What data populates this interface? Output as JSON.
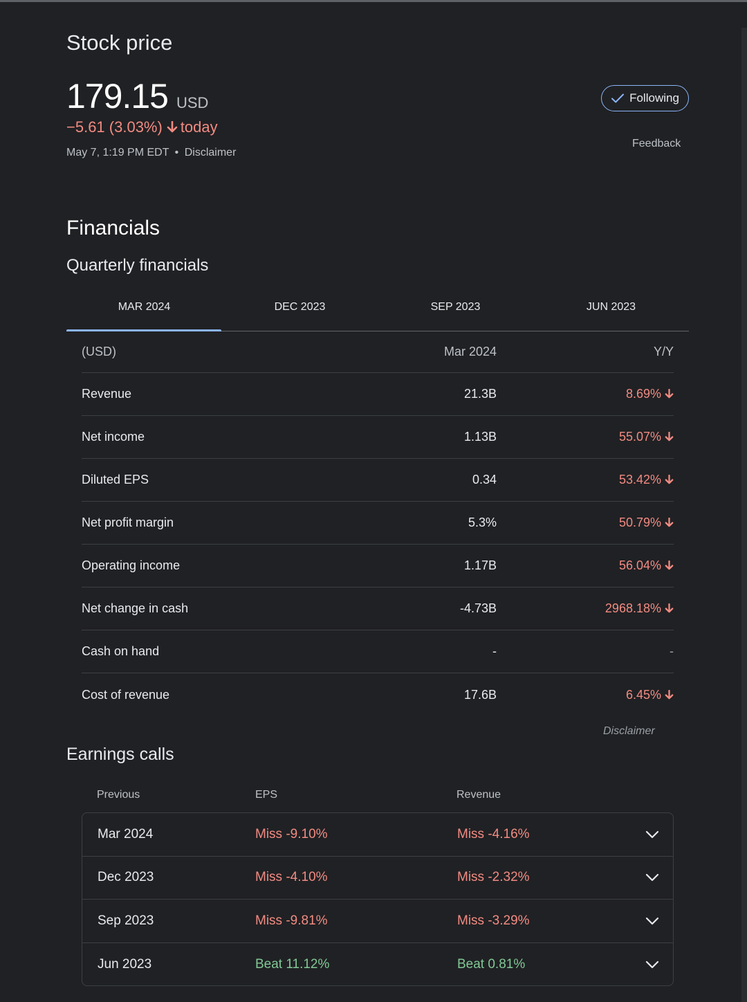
{
  "stock": {
    "title": "Stock price",
    "price": "179.15",
    "currency": "USD",
    "change": "−5.61 (3.03%)",
    "change_suffix": "today",
    "timestamp": "May 7, 1:19 PM EDT",
    "separator": "•",
    "disclaimer": "Disclaimer",
    "following_label": "Following",
    "feedback_label": "Feedback",
    "change_color": "#f28b82"
  },
  "financials": {
    "title": "Financials",
    "subtitle": "Quarterly financials",
    "tabs": [
      {
        "label": "MAR 2024",
        "active": true
      },
      {
        "label": "DEC 2023",
        "active": false
      },
      {
        "label": "SEP 2023",
        "active": false
      },
      {
        "label": "JUN 2023",
        "active": false
      }
    ],
    "header": {
      "label": "(USD)",
      "value": "Mar 2024",
      "yy": "Y/Y"
    },
    "rows": [
      {
        "label": "Revenue",
        "value": "21.3B",
        "yy": "8.69%",
        "trend": "down"
      },
      {
        "label": "Net income",
        "value": "1.13B",
        "yy": "55.07%",
        "trend": "down"
      },
      {
        "label": "Diluted EPS",
        "value": "0.34",
        "yy": "53.42%",
        "trend": "down"
      },
      {
        "label": "Net profit margin",
        "value": "5.3%",
        "yy": "50.79%",
        "trend": "down"
      },
      {
        "label": "Operating income",
        "value": "1.17B",
        "yy": "56.04%",
        "trend": "down"
      },
      {
        "label": "Net change in cash",
        "value": "-4.73B",
        "yy": "2968.18%",
        "trend": "down"
      },
      {
        "label": "Cash on hand",
        "value": "-",
        "yy": "-",
        "trend": "none"
      },
      {
        "label": "Cost of revenue",
        "value": "17.6B",
        "yy": "6.45%",
        "trend": "down"
      }
    ],
    "disclaimer": "Disclaimer"
  },
  "earnings": {
    "title": "Earnings calls",
    "headers": {
      "previous": "Previous",
      "eps": "EPS",
      "revenue": "Revenue"
    },
    "rows": [
      {
        "quarter": "Mar 2024",
        "eps": "Miss -9.10%",
        "eps_status": "miss",
        "revenue": "Miss -4.16%",
        "revenue_status": "miss"
      },
      {
        "quarter": "Dec 2023",
        "eps": "Miss -4.10%",
        "eps_status": "miss",
        "revenue": "Miss -2.32%",
        "revenue_status": "miss"
      },
      {
        "quarter": "Sep 2023",
        "eps": "Miss -9.81%",
        "eps_status": "miss",
        "revenue": "Miss -3.29%",
        "revenue_status": "miss"
      },
      {
        "quarter": "Jun 2023",
        "eps": "Beat 11.12%",
        "eps_status": "beat",
        "revenue": "Beat 0.81%",
        "revenue_status": "beat"
      }
    ]
  },
  "icons": {
    "check": "check-icon",
    "down_arrow": "arrow-down-icon",
    "expand": "chevron-down-icon"
  }
}
